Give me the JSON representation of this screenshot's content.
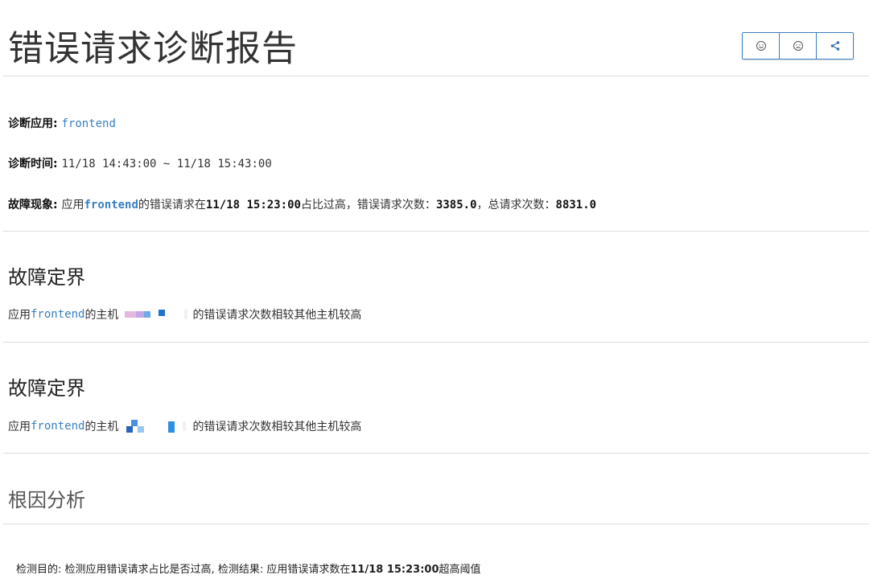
{
  "header": {
    "title": "错误请求诊断报告",
    "buttons": [
      {
        "icon": "smile-icon"
      },
      {
        "icon": "frown-icon"
      },
      {
        "icon": "share-icon"
      }
    ]
  },
  "meta": {
    "app_label": "诊断应用",
    "app_value": "frontend",
    "time_label": "诊断时间",
    "time_value": "11/18 14:43:00 ~ 11/18 15:43:00",
    "symptom_label": "故障现象",
    "symptom_prefix": "应用",
    "symptom_app": "frontend",
    "symptom_mid": "的错误请求在",
    "symptom_time": "11/18 15:23:00",
    "symptom_rest": "占比过高，错误请求次数：",
    "error_count": "3385.0",
    "total_label": "，总请求次数：",
    "total_count": "8831.0"
  },
  "sections": [
    {
      "title": "故障定界",
      "prefix": "应用",
      "app": "frontend",
      "mid": "的主机",
      "suffix": "的错误请求次数相较其他主机较高"
    },
    {
      "title": "故障定界",
      "prefix": "应用",
      "app": "frontend",
      "mid": "的主机",
      "suffix": "的错误请求次数相较其他主机较高"
    },
    {
      "title": "根因分析"
    }
  ],
  "detect": {
    "purpose_label": "检测目的:",
    "purpose_value": "检测应用错误请求占比是否过高,",
    "result_label": "检测结果:",
    "result_prefix": "应用错误请求数在",
    "result_time": "11/18 15:23:00",
    "result_suffix": "超高阈值"
  },
  "colors": {
    "accent": "#3a7fc1",
    "divider": "#dcdcdc"
  }
}
